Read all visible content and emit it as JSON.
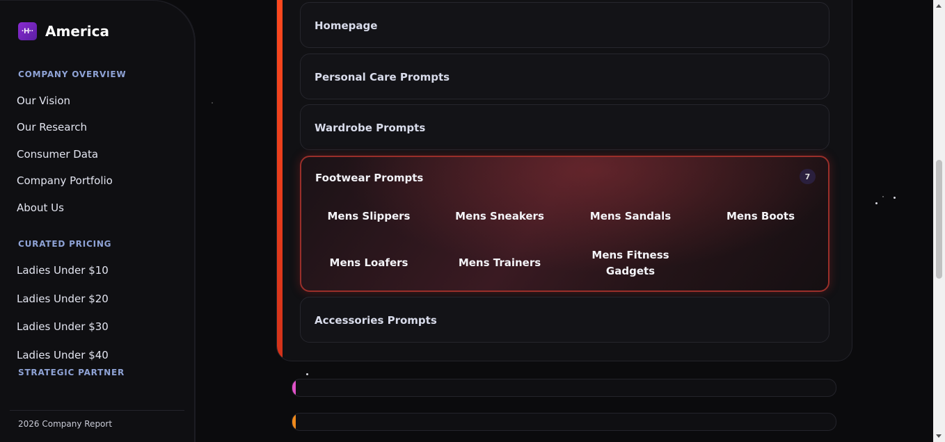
{
  "sidebar": {
    "brand": {
      "logo_text": "·H··",
      "name": "America"
    },
    "sections": [
      {
        "heading": "COMPANY OVERVIEW",
        "items": [
          "Our Vision",
          "Our Research",
          "Consumer Data",
          "Company Portfolio",
          "About Us"
        ]
      },
      {
        "heading": "CURATED PRICING",
        "items": [
          "Ladies Under $10",
          "Ladies Under $20",
          "Ladies Under $30",
          "Ladies Under $40"
        ]
      },
      {
        "heading": "STRATEGIC PARTNER",
        "items": []
      }
    ],
    "footer": "2026 Company Report"
  },
  "main": {
    "accordion": [
      {
        "title": "Homepage"
      },
      {
        "title": "Personal Care Prompts"
      },
      {
        "title": "Wardrobe Prompts"
      },
      {
        "title": "Footwear Prompts",
        "count": "7",
        "expanded": true,
        "subitems": [
          "Mens Slippers",
          "Mens Sneakers",
          "Mens Sandals",
          "Mens Boots",
          "Mens Loafers",
          "Mens Trainers",
          "Mens Fitness Gadgets"
        ]
      },
      {
        "title": "Accessories Prompts"
      }
    ]
  },
  "colors": {
    "accent_red": "#ff4a1e",
    "section_heading": "#8fa3d6",
    "mini_bar_1": "#e052c8",
    "mini_bar_2": "#f08a1c"
  }
}
